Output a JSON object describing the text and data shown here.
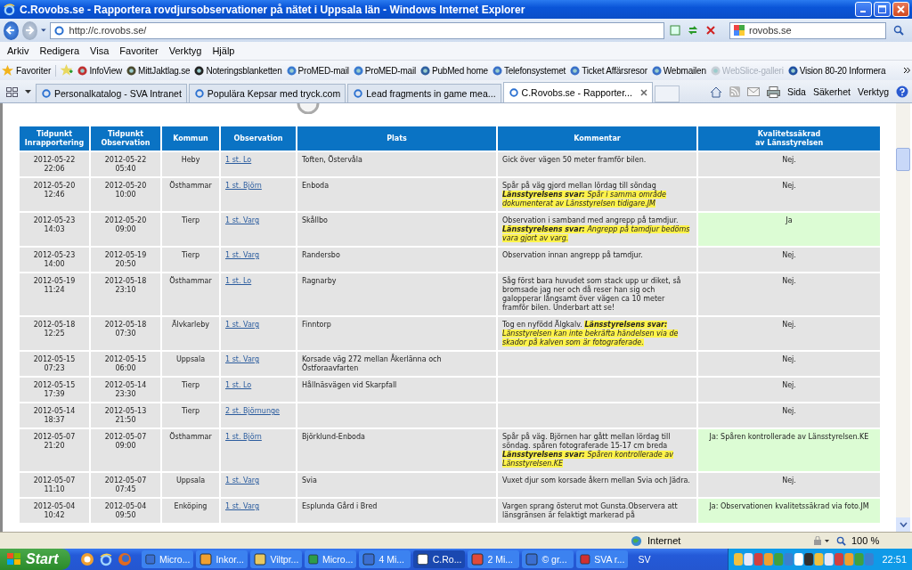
{
  "window": {
    "title": "C.Rovobs.se - Rapportera rovdjursobservationer på nätet i Uppsala län - Windows Internet Explorer"
  },
  "nav": {
    "address": "http://c.rovobs.se/",
    "search": "rovobs.se"
  },
  "menu": [
    "Arkiv",
    "Redigera",
    "Visa",
    "Favoriter",
    "Verktyg",
    "Hjälp"
  ],
  "favorites": {
    "label": "Favoriter",
    "items": [
      {
        "label": "InfoView",
        "disabled": false
      },
      {
        "label": "MittJaktlag.se",
        "disabled": false
      },
      {
        "label": "Noteringsblanketten",
        "disabled": false
      },
      {
        "label": "ProMED-mail",
        "disabled": false
      },
      {
        "label": "ProMED-mail",
        "disabled": false
      },
      {
        "label": "PubMed home",
        "disabled": false
      },
      {
        "label": "Telefonsystemet",
        "disabled": false
      },
      {
        "label": "Ticket Affärsresor",
        "disabled": false
      },
      {
        "label": "Webmailen",
        "disabled": false
      },
      {
        "label": "WebSlice-galleri",
        "disabled": true
      },
      {
        "label": "Vision 80-20 Informera",
        "disabled": false
      }
    ]
  },
  "tabs": [
    {
      "label": "Personalkatalog - SVA Intranet",
      "selected": false
    },
    {
      "label": "Populära Kepsar med tryck.com",
      "selected": false
    },
    {
      "label": "Lead fragments in game mea...",
      "selected": false
    },
    {
      "label": "C.Rovobs.se - Rapporter...",
      "selected": true
    }
  ],
  "command_bar": [
    "Sida",
    "Säkerhet",
    "Verktyg"
  ],
  "table": {
    "columns": [
      "Tidpunkt\nInrapportering",
      "Tidpunkt\nObservation",
      "Kommun",
      "Observation",
      "Plats",
      "Kommentar",
      "Kvalitetssäkrad\nav Länsstyrelsen"
    ],
    "rows": [
      {
        "reported": "2012-05-22\n22:06",
        "observed": "2012-05-22\n05:40",
        "municipality": "Heby",
        "observation": "1 st. Lo",
        "place": "Toften, Östervåla",
        "comment": {
          "text": "Gick över vägen 50 meter framför bilen."
        },
        "verified": false,
        "quality": "Nej."
      },
      {
        "reported": "2012-05-20\n12:46",
        "observed": "2012-05-20\n10:00",
        "municipality": "Östhammar",
        "observation": "1 st. Björn",
        "place": "Enboda",
        "comment": {
          "text": "Spår på väg gjord mellan lördag till söndag",
          "reply_label": "Länsstyrelsens svar:",
          "reply": "Spår i samma område dokumenterat av Länsstyrelsen tidigare.JM"
        },
        "verified": false,
        "quality": "Nej."
      },
      {
        "reported": "2012-05-23\n14:03",
        "observed": "2012-05-20\n09:00",
        "municipality": "Tierp",
        "observation": "1 st. Varg",
        "place": "Skållbo",
        "comment": {
          "text": "Observation i samband med angrepp på tamdjur.",
          "reply_label": "Länsstyrelsens svar:",
          "reply": "Angrepp på tamdjur bedöms vara gjort av varg."
        },
        "verified": true,
        "quality": "Ja"
      },
      {
        "reported": "2012-05-23\n14:00",
        "observed": "2012-05-19\n20:50",
        "municipality": "Tierp",
        "observation": "1 st. Varg",
        "place": "Randersbo",
        "comment": {
          "text": "Observation innan angrepp på tamdjur."
        },
        "verified": false,
        "quality": "Nej."
      },
      {
        "reported": "2012-05-19\n11:24",
        "observed": "2012-05-18\n23:10",
        "municipality": "Östhammar",
        "observation": "1 st. Lo",
        "place": "Ragnarby",
        "comment": {
          "text": "Såg först bara huvudet som stack upp ur diket, så bromsade jag ner och då reser han sig och galopperar långsamt över vägen ca 10 meter framför bilen. Underbart att se!"
        },
        "verified": false,
        "quality": "Nej."
      },
      {
        "reported": "2012-05-18\n12:25",
        "observed": "2012-05-18\n07:30",
        "municipality": "Älvkarleby",
        "observation": "1 st. Varg",
        "place": "Finntorp",
        "comment": {
          "text": "Tog en nyfödd Älgkalv.",
          "reply_label": "Länsstyrelsens svar:",
          "reply": "Länsstyrelsen kan inte bekräfta händelsen via de skador på kalven som är fotograferade."
        },
        "verified": false,
        "quality": "Nej."
      },
      {
        "reported": "2012-05-15\n07:23",
        "observed": "2012-05-15\n06:00",
        "municipality": "Uppsala",
        "observation": "1 st. Varg",
        "place": "Korsade väg 272 mellan Åkerlänna och Östforaavfarten",
        "verified": false,
        "quality": "Nej."
      },
      {
        "reported": "2012-05-15\n17:39",
        "observed": "2012-05-14\n23:30",
        "municipality": "Tierp",
        "observation": "1 st. Lo",
        "place": "Hållnäsvägen vid Skarpfall",
        "verified": false,
        "quality": "Nej."
      },
      {
        "reported": "2012-05-14\n18:37",
        "observed": "2012-05-13\n21:50",
        "municipality": "Tierp",
        "observation": "2 st. Björnunge",
        "verified": false,
        "quality": "Nej."
      },
      {
        "reported": "2012-05-07\n21:20",
        "observed": "2012-05-07\n09:00",
        "municipality": "Östhammar",
        "observation": "1 st. Björn",
        "place": "Björklund-Enboda",
        "comment": {
          "text": "Spår på väg. Björnen har gått mellan lördag till söndag. spåren fotograferade 15-17 cm breda",
          "reply_label": "Länsstyrelsens svar:",
          "reply": "Spåren kontrollerade av Länsstyrelsen.KE"
        },
        "verified": true,
        "quality": "Ja: Spåren kontrollerade av Länsstyrelsen.KE"
      },
      {
        "reported": "2012-05-07\n11:10",
        "observed": "2012-05-07\n07:45",
        "municipality": "Uppsala",
        "observation": "1 st. Varg",
        "place": "Svia",
        "comment": {
          "text": "Vuxet djur som korsade åkern mellan Svia och Jädra."
        },
        "verified": false,
        "quality": "Nej."
      },
      {
        "reported": "2012-05-04\n10:42",
        "observed": "2012-05-04\n09:50",
        "municipality": "Enköping",
        "observation": "1 st. Varg",
        "place": "Esplunda Gård i Bred",
        "comment": {
          "text": "Vargen sprang österut mot Gunsta.Observera att länsgränsen är felaktigt markerad på"
        },
        "verified": true,
        "quality": "Ja: Observationen kvalitetssäkrad via foto.JM"
      }
    ]
  },
  "status_bar": {
    "zone": "Internet",
    "zoom": "100 %"
  },
  "taskbar": {
    "start": "Start",
    "tasks": [
      {
        "label": "Micro...",
        "selected": false
      },
      {
        "label": "Inkor...",
        "selected": false
      },
      {
        "label": "Viltpr...",
        "selected": false
      },
      {
        "label": "Micro...",
        "selected": false
      },
      {
        "label": "4 Mi...",
        "selected": false
      },
      {
        "label": "C.Ro...",
        "selected": true
      },
      {
        "label": "2 Mi...",
        "selected": false
      },
      {
        "label": "© gr...",
        "selected": false
      },
      {
        "label": "SVA r...",
        "selected": false
      }
    ],
    "language": "SV",
    "clock": "22:51"
  }
}
